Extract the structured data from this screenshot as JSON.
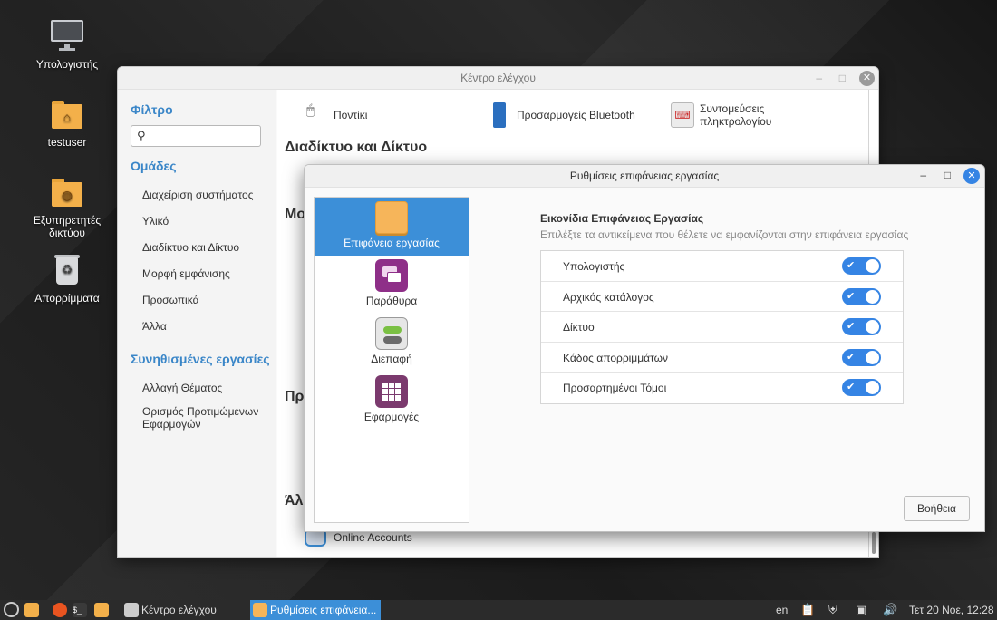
{
  "desktop": {
    "icons": [
      {
        "label": "Υπολογιστής"
      },
      {
        "label": "testuser"
      },
      {
        "label": "Εξυπηρετητές δικτύου"
      },
      {
        "label": "Απορρίμματα"
      }
    ]
  },
  "control_center": {
    "title": "Κέντρο ελέγχου",
    "sidebar": {
      "filter_heading": "Φίλτρο",
      "search_placeholder": "",
      "groups_heading": "Ομάδες",
      "groups": [
        "Διαχείριση συστήματος",
        "Υλικό",
        "Διαδίκτυο και Δίκτυο",
        "Μορφή εμφάνισης",
        "Προσωπικά",
        "Άλλα"
      ],
      "tasks_heading": "Συνηθισμένες εργασίες",
      "tasks": [
        "Αλλαγή Θέματος",
        "Ορισμός Προτιμώμενων Εφαρμογών"
      ]
    },
    "main": {
      "top_items": [
        "Ποντίκι",
        "Προσαρμογείς Bluetooth",
        "Συντομεύσεις πληκτρολογίου"
      ],
      "section_internet": "Διαδίκτυο και Δίκτυο",
      "section_partial_1": "Μο",
      "section_partial_2": "Πρ",
      "section_partial_3": "Άλ",
      "online_accounts": "Online Accounts"
    }
  },
  "desktop_settings": {
    "title": "Ρυθμίσεις επιφάνειας εργασίας",
    "nav": [
      {
        "label": "Επιφάνεια εργασίας",
        "icon": "desktop-icon",
        "active": true
      },
      {
        "label": "Παράθυρα",
        "icon": "windows-icon",
        "active": false
      },
      {
        "label": "Διεπαφή",
        "icon": "interface-icon",
        "active": false
      },
      {
        "label": "Εφαρμογές",
        "icon": "apps-icon",
        "active": false
      }
    ],
    "heading": "Εικονίδια Επιφάνειας Εργασίας",
    "subheading": "Επιλέξτε τα αντικείμενα που θέλετε να εμφανίζονται στην επιφάνεια εργασίας",
    "options": [
      {
        "label": "Υπολογιστής",
        "enabled": true
      },
      {
        "label": "Αρχικός κατάλογος",
        "enabled": true
      },
      {
        "label": "Δίκτυο",
        "enabled": true
      },
      {
        "label": "Κάδος απορριμμάτων",
        "enabled": true
      },
      {
        "label": "Προσαρτημένοι Τόμοι",
        "enabled": true
      }
    ],
    "help_button": "Βοήθεια"
  },
  "taskbar": {
    "tasks": [
      "Κέντρο ελέγχου",
      "Ρυθμίσεις επιφάνεια..."
    ],
    "language": "en",
    "clock": "Τετ 20 Νοε, 12:28"
  },
  "colors": {
    "accent": "#3584e4",
    "nav_active": "#3c8fd8",
    "heading_blue": "#3a86c8"
  }
}
